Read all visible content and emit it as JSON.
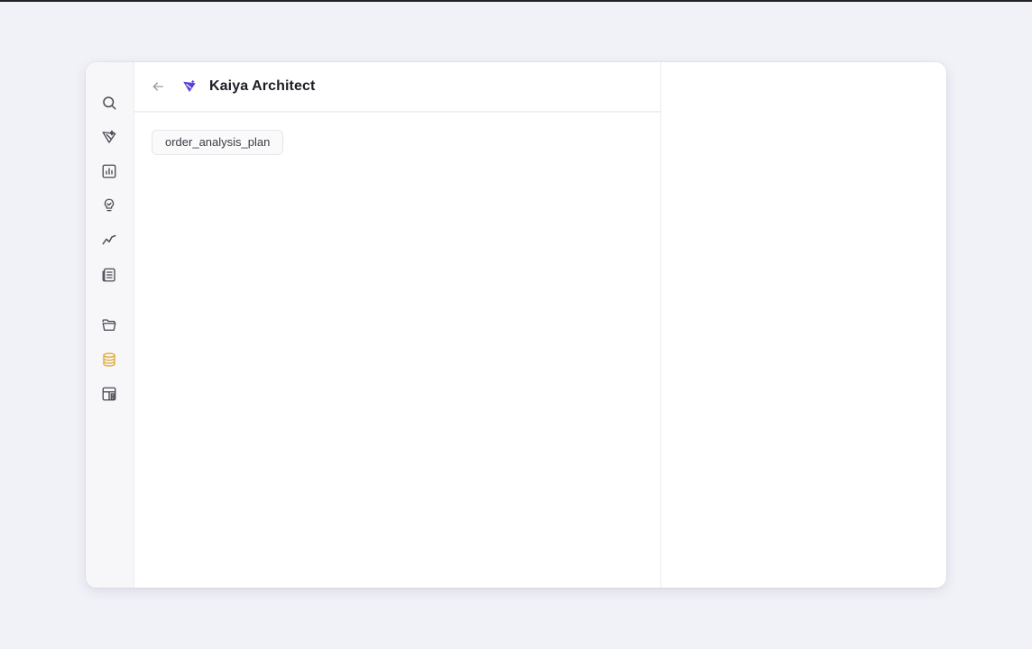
{
  "header": {
    "title": "Kaiya Architect"
  },
  "main": {
    "chip_label": "order_analysis_plan"
  },
  "rail": {
    "items": [
      "search-icon",
      "kaiya-icon",
      "bar-chart-icon",
      "lightbulb-icon",
      "trend-icon",
      "report-icon",
      "folder-icon",
      "database-icon",
      "layout-icon"
    ],
    "active": "database-icon"
  },
  "colors": {
    "brand": "#5b3fd6",
    "active_icon": "#e0a93a"
  }
}
